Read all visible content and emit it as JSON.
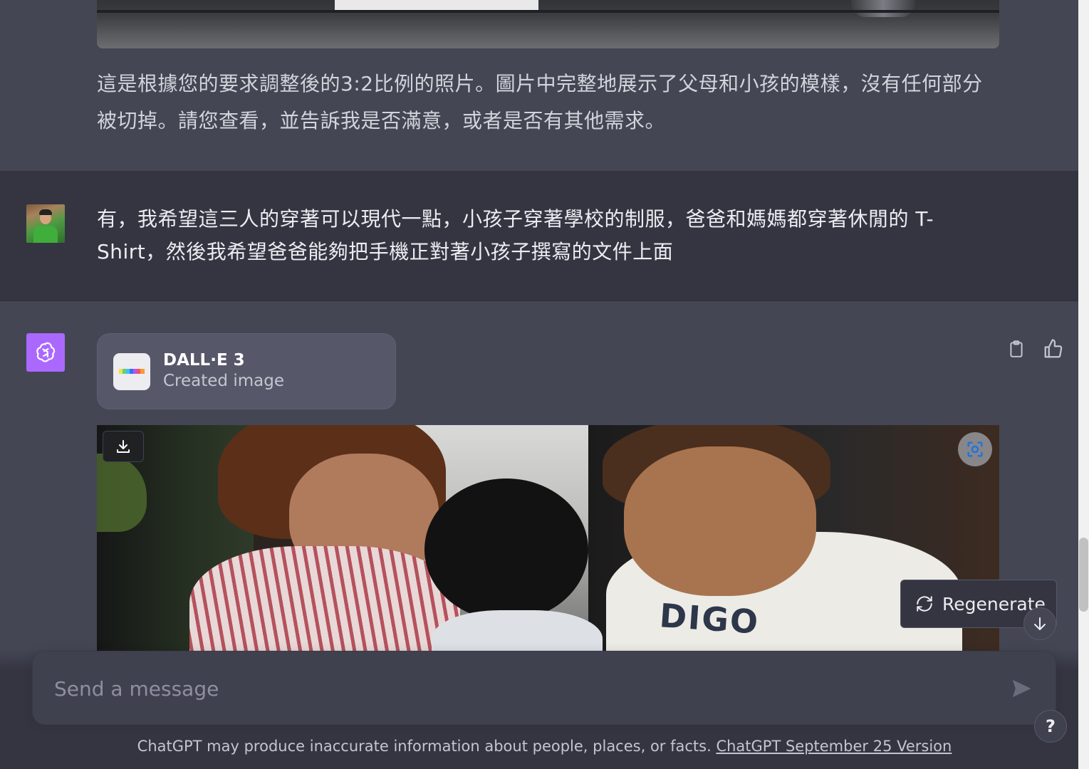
{
  "messages": {
    "previous_assistant": {
      "text": "這是根據您的要求調整後的3:2比例的照片。圖片中完整地展示了父母和小孩的模樣，沒有任何部分被切掉。請您查看，並告訴我是否滿意，或者是否有其他需求。"
    },
    "user": {
      "text": "有，我希望這三人的穿著可以現代一點，小孩子穿著學校的制服，爸爸和媽媽都穿著休閒的 T-Shirt，然後我希望爸爸能夠把手機正對著小孩子撰寫的文件上面"
    },
    "assistant": {
      "tool_title": "DALL·E 3",
      "tool_subtitle": "Created image",
      "image_shirt_text": "DIGO"
    }
  },
  "regenerate": {
    "label": "Regenerate"
  },
  "composer": {
    "placeholder": "Send a message"
  },
  "footer": {
    "disclaimer": "ChatGPT may produce inaccurate information about people, places, or facts. ",
    "version_link": "ChatGPT September 25 Version"
  },
  "help": {
    "label": "?"
  },
  "icons": {
    "copy": "clipboard-icon",
    "like": "thumbs-up-icon",
    "download": "download-icon",
    "lens": "scan-icon",
    "regenerate": "refresh-icon",
    "scroll_down": "arrow-down-icon",
    "send": "send-icon",
    "gpt": "openai-logo-icon"
  },
  "colors": {
    "background": "#343541",
    "assistant_bg": "#444654",
    "gpt_avatar": "#ab68ff",
    "input_bg": "#40414f"
  }
}
